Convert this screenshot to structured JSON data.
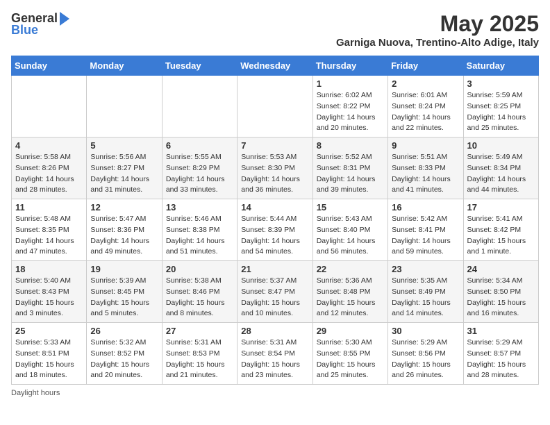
{
  "header": {
    "logo_general": "General",
    "logo_blue": "Blue",
    "month_title": "May 2025",
    "subtitle": "Garniga Nuova, Trentino-Alto Adige, Italy"
  },
  "days_of_week": [
    "Sunday",
    "Monday",
    "Tuesday",
    "Wednesday",
    "Thursday",
    "Friday",
    "Saturday"
  ],
  "weeks": [
    [
      {
        "num": "",
        "sunrise": "",
        "sunset": "",
        "daylight": ""
      },
      {
        "num": "",
        "sunrise": "",
        "sunset": "",
        "daylight": ""
      },
      {
        "num": "",
        "sunrise": "",
        "sunset": "",
        "daylight": ""
      },
      {
        "num": "",
        "sunrise": "",
        "sunset": "",
        "daylight": ""
      },
      {
        "num": "1",
        "sunrise": "Sunrise: 6:02 AM",
        "sunset": "Sunset: 8:22 PM",
        "daylight": "Daylight: 14 hours and 20 minutes."
      },
      {
        "num": "2",
        "sunrise": "Sunrise: 6:01 AM",
        "sunset": "Sunset: 8:24 PM",
        "daylight": "Daylight: 14 hours and 22 minutes."
      },
      {
        "num": "3",
        "sunrise": "Sunrise: 5:59 AM",
        "sunset": "Sunset: 8:25 PM",
        "daylight": "Daylight: 14 hours and 25 minutes."
      }
    ],
    [
      {
        "num": "4",
        "sunrise": "Sunrise: 5:58 AM",
        "sunset": "Sunset: 8:26 PM",
        "daylight": "Daylight: 14 hours and 28 minutes."
      },
      {
        "num": "5",
        "sunrise": "Sunrise: 5:56 AM",
        "sunset": "Sunset: 8:27 PM",
        "daylight": "Daylight: 14 hours and 31 minutes."
      },
      {
        "num": "6",
        "sunrise": "Sunrise: 5:55 AM",
        "sunset": "Sunset: 8:29 PM",
        "daylight": "Daylight: 14 hours and 33 minutes."
      },
      {
        "num": "7",
        "sunrise": "Sunrise: 5:53 AM",
        "sunset": "Sunset: 8:30 PM",
        "daylight": "Daylight: 14 hours and 36 minutes."
      },
      {
        "num": "8",
        "sunrise": "Sunrise: 5:52 AM",
        "sunset": "Sunset: 8:31 PM",
        "daylight": "Daylight: 14 hours and 39 minutes."
      },
      {
        "num": "9",
        "sunrise": "Sunrise: 5:51 AM",
        "sunset": "Sunset: 8:33 PM",
        "daylight": "Daylight: 14 hours and 41 minutes."
      },
      {
        "num": "10",
        "sunrise": "Sunrise: 5:49 AM",
        "sunset": "Sunset: 8:34 PM",
        "daylight": "Daylight: 14 hours and 44 minutes."
      }
    ],
    [
      {
        "num": "11",
        "sunrise": "Sunrise: 5:48 AM",
        "sunset": "Sunset: 8:35 PM",
        "daylight": "Daylight: 14 hours and 47 minutes."
      },
      {
        "num": "12",
        "sunrise": "Sunrise: 5:47 AM",
        "sunset": "Sunset: 8:36 PM",
        "daylight": "Daylight: 14 hours and 49 minutes."
      },
      {
        "num": "13",
        "sunrise": "Sunrise: 5:46 AM",
        "sunset": "Sunset: 8:38 PM",
        "daylight": "Daylight: 14 hours and 51 minutes."
      },
      {
        "num": "14",
        "sunrise": "Sunrise: 5:44 AM",
        "sunset": "Sunset: 8:39 PM",
        "daylight": "Daylight: 14 hours and 54 minutes."
      },
      {
        "num": "15",
        "sunrise": "Sunrise: 5:43 AM",
        "sunset": "Sunset: 8:40 PM",
        "daylight": "Daylight: 14 hours and 56 minutes."
      },
      {
        "num": "16",
        "sunrise": "Sunrise: 5:42 AM",
        "sunset": "Sunset: 8:41 PM",
        "daylight": "Daylight: 14 hours and 59 minutes."
      },
      {
        "num": "17",
        "sunrise": "Sunrise: 5:41 AM",
        "sunset": "Sunset: 8:42 PM",
        "daylight": "Daylight: 15 hours and 1 minute."
      }
    ],
    [
      {
        "num": "18",
        "sunrise": "Sunrise: 5:40 AM",
        "sunset": "Sunset: 8:43 PM",
        "daylight": "Daylight: 15 hours and 3 minutes."
      },
      {
        "num": "19",
        "sunrise": "Sunrise: 5:39 AM",
        "sunset": "Sunset: 8:45 PM",
        "daylight": "Daylight: 15 hours and 5 minutes."
      },
      {
        "num": "20",
        "sunrise": "Sunrise: 5:38 AM",
        "sunset": "Sunset: 8:46 PM",
        "daylight": "Daylight: 15 hours and 8 minutes."
      },
      {
        "num": "21",
        "sunrise": "Sunrise: 5:37 AM",
        "sunset": "Sunset: 8:47 PM",
        "daylight": "Daylight: 15 hours and 10 minutes."
      },
      {
        "num": "22",
        "sunrise": "Sunrise: 5:36 AM",
        "sunset": "Sunset: 8:48 PM",
        "daylight": "Daylight: 15 hours and 12 minutes."
      },
      {
        "num": "23",
        "sunrise": "Sunrise: 5:35 AM",
        "sunset": "Sunset: 8:49 PM",
        "daylight": "Daylight: 15 hours and 14 minutes."
      },
      {
        "num": "24",
        "sunrise": "Sunrise: 5:34 AM",
        "sunset": "Sunset: 8:50 PM",
        "daylight": "Daylight: 15 hours and 16 minutes."
      }
    ],
    [
      {
        "num": "25",
        "sunrise": "Sunrise: 5:33 AM",
        "sunset": "Sunset: 8:51 PM",
        "daylight": "Daylight: 15 hours and 18 minutes."
      },
      {
        "num": "26",
        "sunrise": "Sunrise: 5:32 AM",
        "sunset": "Sunset: 8:52 PM",
        "daylight": "Daylight: 15 hours and 20 minutes."
      },
      {
        "num": "27",
        "sunrise": "Sunrise: 5:31 AM",
        "sunset": "Sunset: 8:53 PM",
        "daylight": "Daylight: 15 hours and 21 minutes."
      },
      {
        "num": "28",
        "sunrise": "Sunrise: 5:31 AM",
        "sunset": "Sunset: 8:54 PM",
        "daylight": "Daylight: 15 hours and 23 minutes."
      },
      {
        "num": "29",
        "sunrise": "Sunrise: 5:30 AM",
        "sunset": "Sunset: 8:55 PM",
        "daylight": "Daylight: 15 hours and 25 minutes."
      },
      {
        "num": "30",
        "sunrise": "Sunrise: 5:29 AM",
        "sunset": "Sunset: 8:56 PM",
        "daylight": "Daylight: 15 hours and 26 minutes."
      },
      {
        "num": "31",
        "sunrise": "Sunrise: 5:29 AM",
        "sunset": "Sunset: 8:57 PM",
        "daylight": "Daylight: 15 hours and 28 minutes."
      }
    ]
  ],
  "footer": {
    "note": "Daylight hours"
  }
}
